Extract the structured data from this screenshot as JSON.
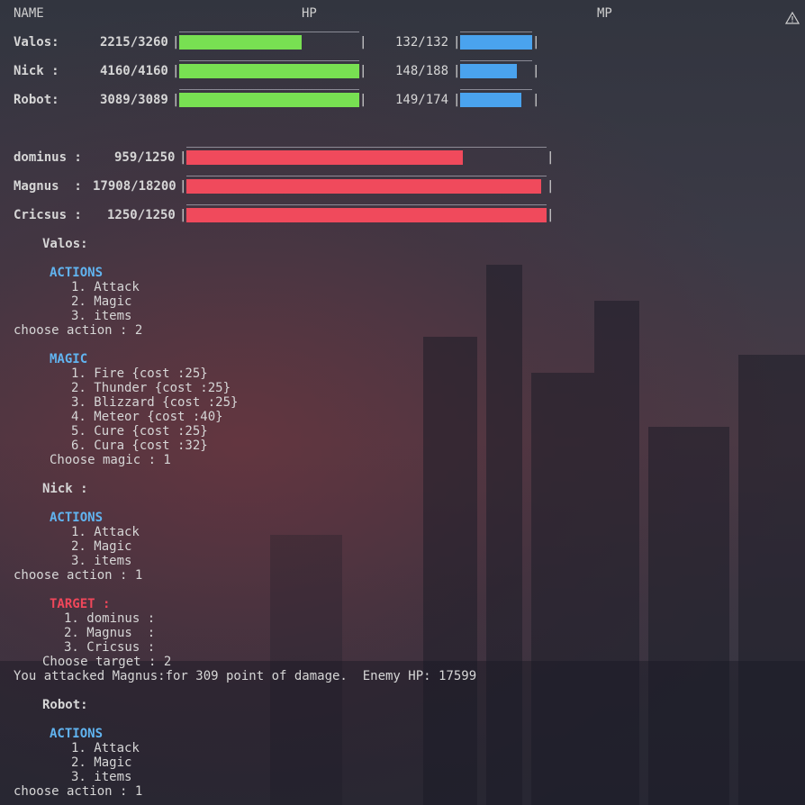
{
  "header": {
    "name": "NAME",
    "hp": "HP",
    "mp": "MP",
    "icon": "warning-icon"
  },
  "party": [
    {
      "name": "Valos:",
      "hp_text": "2215/3260",
      "hp_frac": 0.679,
      "mp_text": "132/132",
      "mp_frac": 1.0
    },
    {
      "name": "Nick :",
      "hp_text": "4160/4160",
      "hp_frac": 1.0,
      "mp_text": "148/188",
      "mp_frac": 0.787
    },
    {
      "name": "Robot:",
      "hp_text": "3089/3089",
      "hp_frac": 1.0,
      "mp_text": "149/174",
      "mp_frac": 0.856
    }
  ],
  "enemies": [
    {
      "name": "dominus :",
      "hp_text": "959/1250",
      "hp_frac": 0.767
    },
    {
      "name": "Magnus  :",
      "hp_text": "17908/18200",
      "hp_frac": 0.984
    },
    {
      "name": "Cricsus :",
      "hp_text": "1250/1250",
      "hp_frac": 1.0
    }
  ],
  "colors": {
    "hp_fill": "#78e052",
    "mp_fill": "#4aa3ee",
    "enemy_fill": "#f04a5c",
    "actions": "#61b4f0",
    "target": "#f0475a"
  },
  "log": [
    "Valos:",
    "ACTIONS",
    "1. Attack",
    "2. Magic",
    "3. items",
    "choose action : 2",
    "MAGIC",
    "1. Fire {cost :25}",
    "2. Thunder {cost :25}",
    "3. Blizzard {cost :25}",
    "4. Meteor {cost :40}",
    "5. Cure {cost :25}",
    "6. Cura {cost :32}",
    "Choose magic : 1",
    "Nick :",
    "ACTIONS",
    "1. Attack",
    "2. Magic",
    "3. items",
    "choose action : 1",
    "TARGET :",
    "1. dominus :",
    "2. Magnus  :",
    "3. Cricsus :",
    "Choose target : 2",
    "You attacked Magnus:for 309 point of damage.  Enemy HP: 17599",
    "Robot:",
    "ACTIONS",
    "1. Attack",
    "2. Magic",
    "3. items",
    "choose action : 1"
  ]
}
